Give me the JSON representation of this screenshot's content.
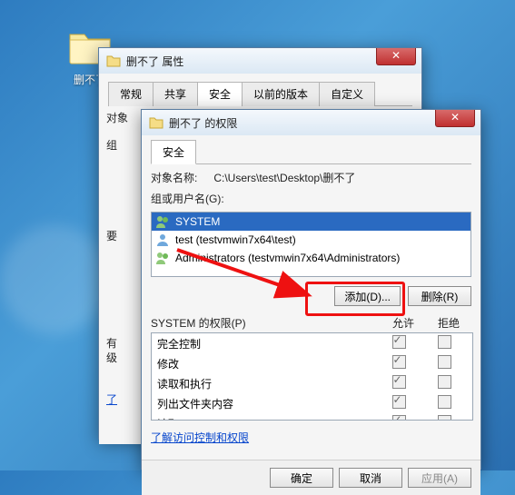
{
  "desktop": {
    "icon_label": "删不了",
    "icon_name": "folder-icon"
  },
  "prop_window": {
    "title": "删不了 属性",
    "tabs": [
      "常规",
      "共享",
      "安全",
      "以前的版本",
      "自定义"
    ],
    "active_tab_index": 2,
    "obj_prefix": "对象",
    "group_label": "组",
    "req_label": "要",
    "side_text1": "有",
    "side_text2": "级",
    "link": "了"
  },
  "perm_window": {
    "title": "删不了 的权限",
    "tabs": [
      "安全"
    ],
    "object_name_label": "对象名称:",
    "object_name_value": "C:\\Users\\test\\Desktop\\删不了",
    "group_label": "组或用户名(G):",
    "users": [
      {
        "name": "SYSTEM",
        "selected": true
      },
      {
        "name": "test (testvmwin7x64\\test)",
        "selected": false
      },
      {
        "name": "Administrators (testvmwin7x64\\Administrators)",
        "selected": false
      }
    ],
    "add_button": "添加(D)...",
    "remove_button": "删除(R)",
    "perm_header": "SYSTEM 的权限(P)",
    "col_allow": "允许",
    "col_deny": "拒绝",
    "permissions": [
      {
        "name": "完全控制",
        "allow": true,
        "deny": false
      },
      {
        "name": "修改",
        "allow": true,
        "deny": false
      },
      {
        "name": "读取和执行",
        "allow": true,
        "deny": false
      },
      {
        "name": "列出文件夹内容",
        "allow": true,
        "deny": false
      },
      {
        "name": "读取",
        "allow": true,
        "deny": false
      }
    ],
    "learn_link": "了解访问控制和权限",
    "ok": "确定",
    "cancel": "取消",
    "apply": "应用(A)"
  },
  "colors": {
    "highlight": "#e11b1b",
    "selection": "#2a6ac1"
  }
}
